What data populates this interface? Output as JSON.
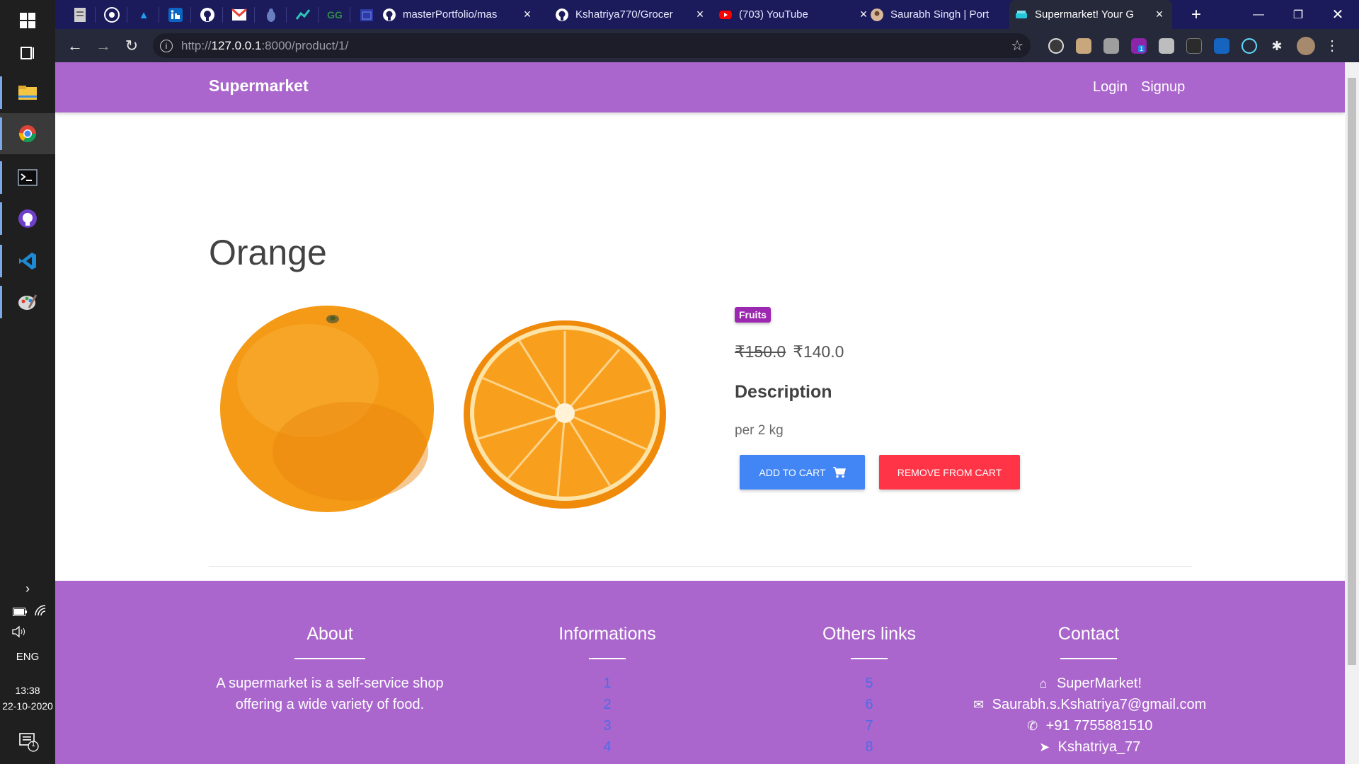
{
  "taskbar": {
    "apps": [
      "file-explorer-icon",
      "chrome-icon",
      "terminal-icon",
      "github-desktop-icon",
      "vscode-icon",
      "paint-icon"
    ],
    "language": "ENG",
    "time": "13:38",
    "date": "22-10-2020",
    "notification_count": "1"
  },
  "browser": {
    "tabs": [
      {
        "title": "masterPortfolio/mas",
        "favicon": "github-icon",
        "active": false
      },
      {
        "title": "Kshatriya770/Grocer",
        "favicon": "github-icon",
        "active": false
      },
      {
        "title": "(703) YouTube",
        "favicon": "youtube-icon",
        "active": false
      },
      {
        "title": "Saurabh Singh | Port",
        "favicon": "avatar-icon",
        "active": false
      },
      {
        "title": "Supermarket! Your G",
        "favicon": "supermarket-icon",
        "active": true
      }
    ],
    "url_prefix": "http://",
    "url_host": "127.0.0.1",
    "url_path": ":8000/product/1/",
    "extension_badge": "1"
  },
  "navbar": {
    "brand": "Supermarket",
    "links": [
      "Login",
      "Signup"
    ]
  },
  "product": {
    "name": "Orange",
    "category": "Fruits",
    "old_price": "₹150.0",
    "price": "₹140.0",
    "description_heading": "Description",
    "description": "per 2 kg",
    "add_button": "ADD TO CART",
    "remove_button": "REMOVE FROM CART"
  },
  "footer": {
    "about": {
      "title": "About",
      "line1": "A supermarket is a self-service shop",
      "line2": "offering a wide variety of food."
    },
    "informations": {
      "title": "Informations",
      "links": [
        "1",
        "2",
        "3",
        "4"
      ]
    },
    "others": {
      "title": "Others links",
      "links": [
        "5",
        "6",
        "7",
        "8"
      ]
    },
    "contact": {
      "title": "Contact",
      "name": "SuperMarket!",
      "email": "Saurabh.s.Kshatriya7@gmail.com",
      "phone": "+91 7755881510",
      "telegram": "Kshatriya_77"
    }
  },
  "colors": {
    "primary": "#aa66cc",
    "category": "#9c27b0",
    "add_button": "#4285f4",
    "remove_button": "#ff3547",
    "footer_link": "#4d6be8"
  }
}
